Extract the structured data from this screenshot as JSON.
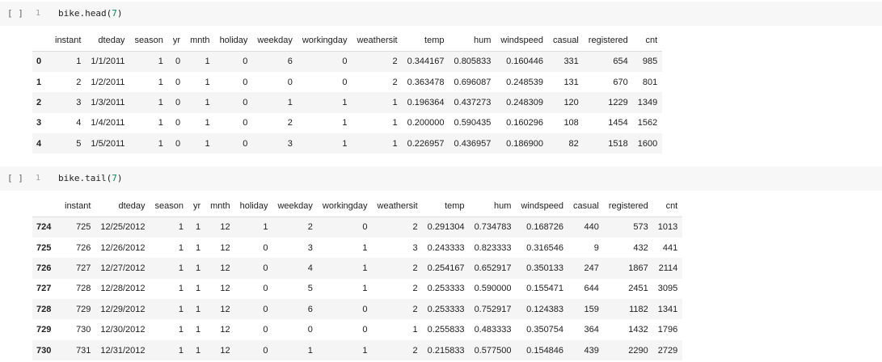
{
  "cells": [
    {
      "run_label": "[ ]",
      "line_number": "1",
      "code_prefix": "bike.head(",
      "code_arg": "7",
      "code_suffix": ")",
      "columns": [
        "instant",
        "dteday",
        "season",
        "yr",
        "mnth",
        "holiday",
        "weekday",
        "workingday",
        "weathersit",
        "temp",
        "hum",
        "windspeed",
        "casual",
        "registered",
        "cnt"
      ],
      "rows": [
        {
          "index": "0",
          "values": [
            "1",
            "1/1/2011",
            "1",
            "0",
            "1",
            "0",
            "6",
            "0",
            "2",
            "0.344167",
            "0.805833",
            "0.160446",
            "331",
            "654",
            "985"
          ]
        },
        {
          "index": "1",
          "values": [
            "2",
            "1/2/2011",
            "1",
            "0",
            "1",
            "0",
            "0",
            "0",
            "2",
            "0.363478",
            "0.696087",
            "0.248539",
            "131",
            "670",
            "801"
          ]
        },
        {
          "index": "2",
          "values": [
            "3",
            "1/3/2011",
            "1",
            "0",
            "1",
            "0",
            "1",
            "1",
            "1",
            "0.196364",
            "0.437273",
            "0.248309",
            "120",
            "1229",
            "1349"
          ]
        },
        {
          "index": "3",
          "values": [
            "4",
            "1/4/2011",
            "1",
            "0",
            "1",
            "0",
            "2",
            "1",
            "1",
            "0.200000",
            "0.590435",
            "0.160296",
            "108",
            "1454",
            "1562"
          ]
        },
        {
          "index": "4",
          "values": [
            "5",
            "1/5/2011",
            "1",
            "0",
            "1",
            "0",
            "3",
            "1",
            "1",
            "0.226957",
            "0.436957",
            "0.186900",
            "82",
            "1518",
            "1600"
          ]
        }
      ]
    },
    {
      "run_label": "[ ]",
      "line_number": "1",
      "code_prefix": "bike.tail(",
      "code_arg": "7",
      "code_suffix": ")",
      "columns": [
        "instant",
        "dteday",
        "season",
        "yr",
        "mnth",
        "holiday",
        "weekday",
        "workingday",
        "weathersit",
        "temp",
        "hum",
        "windspeed",
        "casual",
        "registered",
        "cnt"
      ],
      "rows": [
        {
          "index": "724",
          "values": [
            "725",
            "12/25/2012",
            "1",
            "1",
            "12",
            "1",
            "2",
            "0",
            "2",
            "0.291304",
            "0.734783",
            "0.168726",
            "440",
            "573",
            "1013"
          ]
        },
        {
          "index": "725",
          "values": [
            "726",
            "12/26/2012",
            "1",
            "1",
            "12",
            "0",
            "3",
            "1",
            "3",
            "0.243333",
            "0.823333",
            "0.316546",
            "9",
            "432",
            "441"
          ]
        },
        {
          "index": "726",
          "values": [
            "727",
            "12/27/2012",
            "1",
            "1",
            "12",
            "0",
            "4",
            "1",
            "2",
            "0.254167",
            "0.652917",
            "0.350133",
            "247",
            "1867",
            "2114"
          ]
        },
        {
          "index": "727",
          "values": [
            "728",
            "12/28/2012",
            "1",
            "1",
            "12",
            "0",
            "5",
            "1",
            "2",
            "0.253333",
            "0.590000",
            "0.155471",
            "644",
            "2451",
            "3095"
          ]
        },
        {
          "index": "728",
          "values": [
            "729",
            "12/29/2012",
            "1",
            "1",
            "12",
            "0",
            "6",
            "0",
            "2",
            "0.253333",
            "0.752917",
            "0.124383",
            "159",
            "1182",
            "1341"
          ]
        },
        {
          "index": "729",
          "values": [
            "730",
            "12/30/2012",
            "1",
            "1",
            "12",
            "0",
            "0",
            "0",
            "1",
            "0.255833",
            "0.483333",
            "0.350754",
            "364",
            "1432",
            "1796"
          ]
        },
        {
          "index": "730",
          "values": [
            "731",
            "12/31/2012",
            "1",
            "1",
            "12",
            "0",
            "1",
            "1",
            "2",
            "0.215833",
            "0.577500",
            "0.154846",
            "439",
            "2290",
            "2729"
          ]
        }
      ]
    }
  ]
}
